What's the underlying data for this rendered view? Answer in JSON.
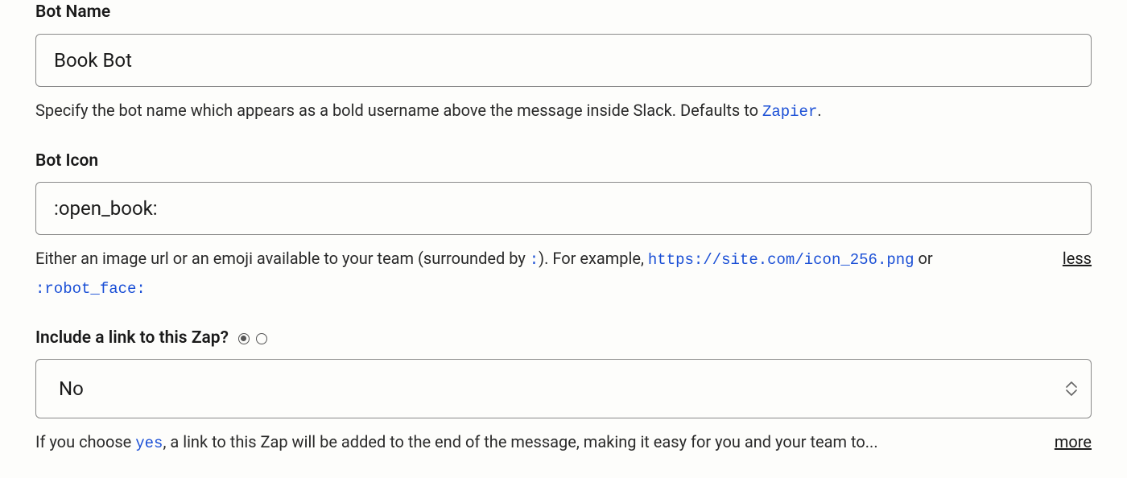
{
  "botName": {
    "label": "Bot Name",
    "value": "Book Bot",
    "help_prefix": "Specify the bot name which appears as a bold username above the message inside Slack. Defaults to ",
    "help_code": "Zapier",
    "help_suffix": "."
  },
  "botIcon": {
    "label": "Bot Icon",
    "value": ":open_book:",
    "help_prefix": "Either an image url or an emoji available to your team (surrounded by ",
    "help_colon": ":",
    "help_mid": "). For example, ",
    "help_url": "https://site.com/icon_256.png",
    "help_or": " or ",
    "help_emoji": ":robot_face:",
    "toggle": "less"
  },
  "includeLink": {
    "label": "Include a link to this Zap?",
    "value": "No",
    "help_prefix": "If you choose ",
    "help_code": "yes",
    "help_suffix": ", a link to this Zap will be added to the end of the message, making it easy for you and your team to...",
    "toggle": "more"
  }
}
